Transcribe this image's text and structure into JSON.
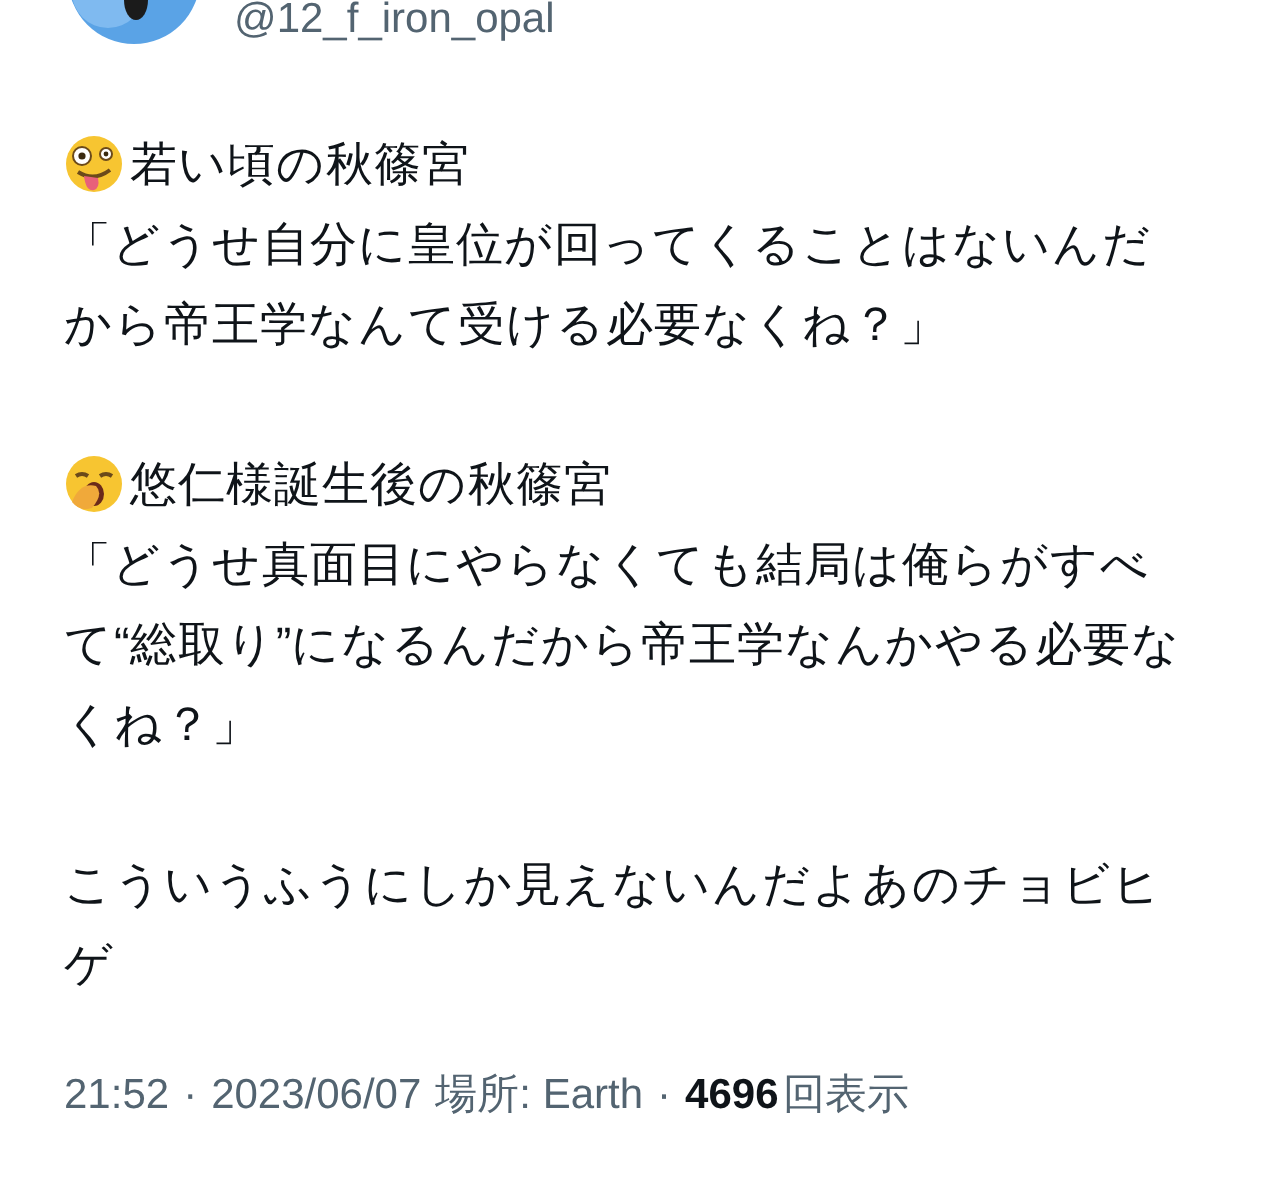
{
  "author": {
    "handle": "@12_f_iron_opal"
  },
  "sections": [
    {
      "kind": "zany",
      "heading": "若い頃の秋篠宮",
      "quote": "「どうせ自分に皇位が回ってくることはないんだから帝王学なんて受ける必要なくね？」"
    },
    {
      "kind": "yawn",
      "heading": "悠仁様誕生後の秋篠宮",
      "quote": "「どうせ真面目にやらなくても結局は俺らがすべて“総取り”になるんだから帝王学なんかやる必要なくね？」"
    }
  ],
  "closing": "こういうふうにしか見えないんだよあのチョビヒゲ",
  "meta": {
    "time": "21:52",
    "separator_1": "·",
    "date": "2023/06/07",
    "location": "場所: Earth",
    "separator_2": "·",
    "views": "4696",
    "views_label": "回表示"
  }
}
